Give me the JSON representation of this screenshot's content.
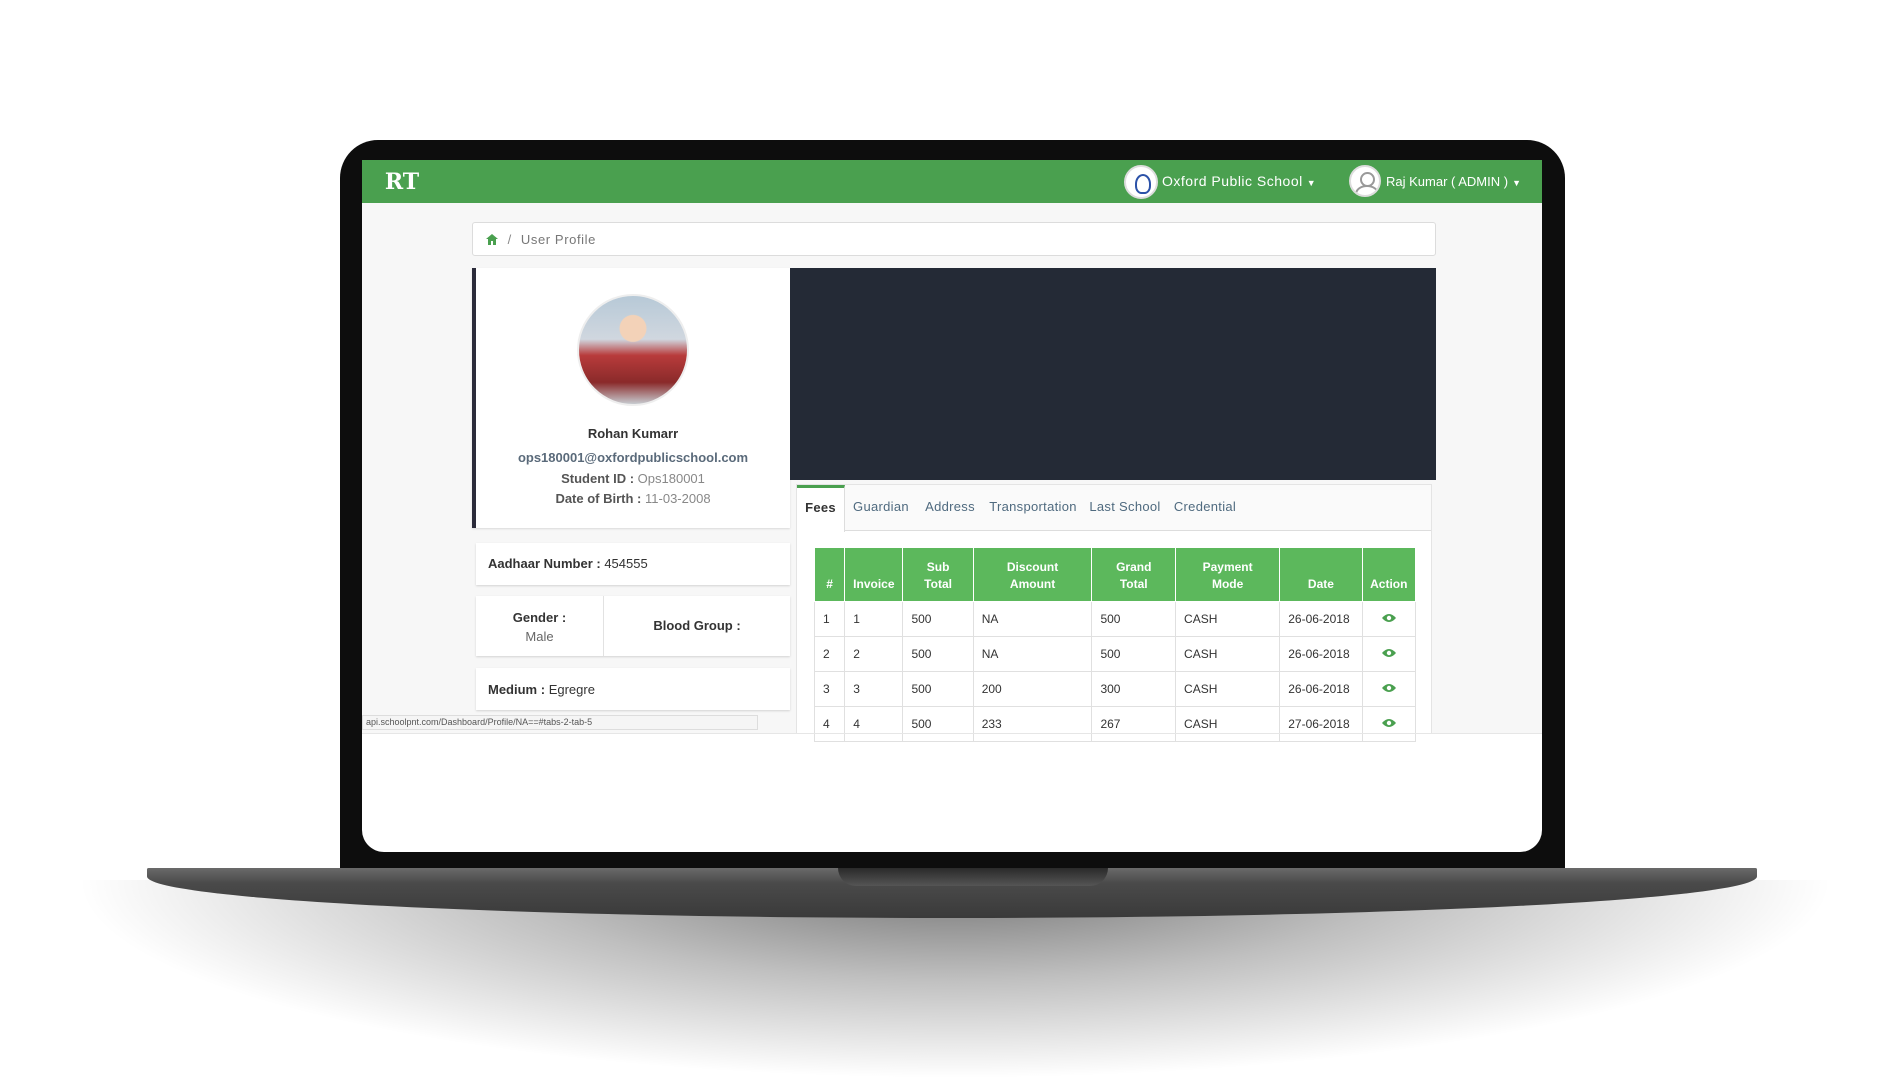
{
  "header": {
    "logo_text": "RT",
    "school_name": "Oxford Public School",
    "user_name": "Raj Kumar ( ADMIN )"
  },
  "breadcrumb": {
    "label": "User Profile"
  },
  "profile": {
    "name": "Rohan Kumarr",
    "email": "ops180001@oxfordpublicschool.com",
    "student_id_label": "Student ID :",
    "student_id": "Ops180001",
    "dob_label": "Date of Birth :",
    "dob": "11-03-2008"
  },
  "details": {
    "aadhaar_label": "Aadhaar Number :",
    "aadhaar": "454555",
    "gender_label": "Gender :",
    "gender": "Male",
    "blood_label": "Blood Group :",
    "blood": "",
    "medium_label": "Medium :",
    "medium": "Egregre"
  },
  "status_url": "api.schoolpnt.com/Dashboard/Profile/NA==#tabs-2-tab-5",
  "tabs": [
    "Fees",
    "Guardian",
    "Address",
    "Transportation",
    "Last School",
    "Credential"
  ],
  "fees_table": {
    "headers": [
      "#",
      "Invoice",
      "Sub Total",
      "Discount Amount",
      "Grand Total",
      "Payment Mode",
      "Date",
      "Action"
    ],
    "rows": [
      [
        "1",
        "1",
        "500",
        "NA",
        "500",
        "CASH",
        "26-06-2018"
      ],
      [
        "2",
        "2",
        "500",
        "NA",
        "500",
        "CASH",
        "26-06-2018"
      ],
      [
        "3",
        "3",
        "500",
        "200",
        "300",
        "CASH",
        "26-06-2018"
      ],
      [
        "4",
        "4",
        "500",
        "233",
        "267",
        "CASH",
        "27-06-2018"
      ]
    ]
  },
  "colors": {
    "brand_green": "#4aa04f",
    "table_header": "#5cb85c",
    "banner": "#242a36"
  }
}
